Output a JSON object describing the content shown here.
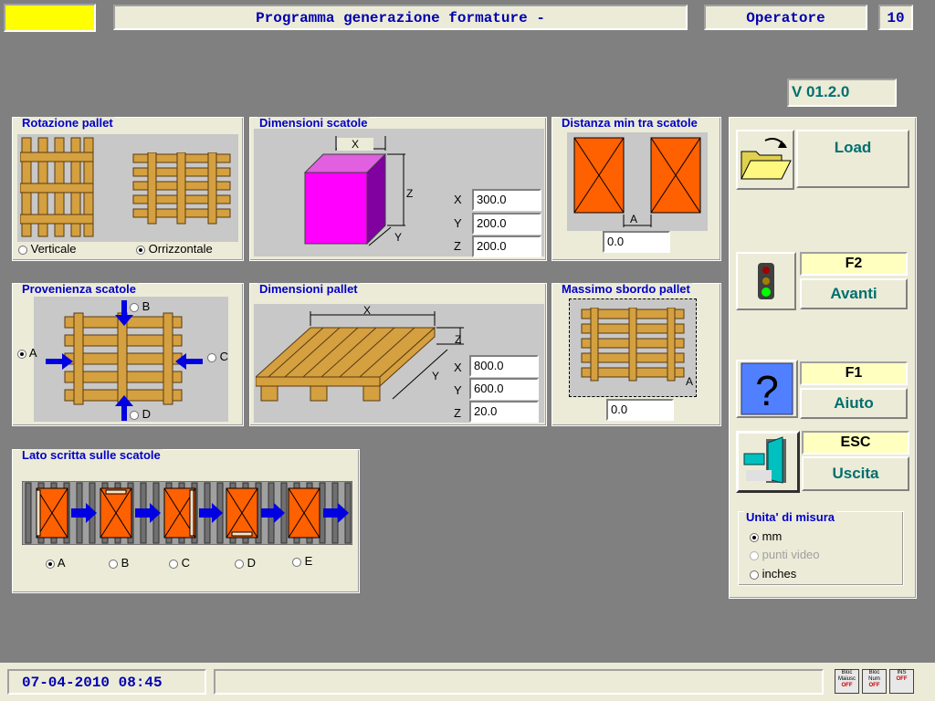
{
  "header": {
    "title": "Programma generazione formature -",
    "user": "Operatore",
    "level": "10",
    "indicator_color": "#ffff00"
  },
  "version": "V 01.2.0",
  "rotazione": {
    "title": "Rotazione pallet",
    "options": [
      "Verticale",
      "Orrizzontale"
    ],
    "selected": "Orrizzontale"
  },
  "dim_scatole": {
    "title": "Dimensioni scatole",
    "axis_x": "X",
    "axis_y": "Y",
    "axis_z": "Z",
    "x": "300.0",
    "y": "200.0",
    "z": "200.0"
  },
  "distanza": {
    "title": "Distanza min tra scatole",
    "axis": "A",
    "value": "0.0"
  },
  "provenienza": {
    "title": "Provenienza scatole",
    "options": [
      "A",
      "B",
      "C",
      "D"
    ],
    "selected": "A"
  },
  "dim_pallet": {
    "title": "Dimensioni pallet",
    "axis_x": "X",
    "axis_y": "Y",
    "axis_z": "Z",
    "x": "800.0",
    "y": "600.0",
    "z": "20.0"
  },
  "sbordo": {
    "title": "Massimo sbordo pallet",
    "axis": "A",
    "value": "0.0"
  },
  "lato_scritta": {
    "title": "Lato scritta sulle scatole",
    "options": [
      "A",
      "B",
      "C",
      "D",
      "E"
    ],
    "selected": "A"
  },
  "side_panel": {
    "load_label": "Load",
    "avanti_key": "F2",
    "avanti_label": "Avanti",
    "aiuto_key": "F1",
    "aiuto_label": "Aiuto",
    "uscita_key": "ESC",
    "uscita_label": "Uscita",
    "units_title": "Unita' di misura",
    "units": [
      "mm",
      "punti video",
      "inches"
    ],
    "units_selected": "mm"
  },
  "footer": {
    "datetime": "07-04-2010 08:45",
    "status_text": "",
    "indicators": [
      {
        "line1": "Bloc",
        "line2": "Maiusc",
        "state": "OFF"
      },
      {
        "line1": "Bloc",
        "line2": "Num",
        "state": "OFF"
      },
      {
        "line1": "INS",
        "line2": "",
        "state": "OFF"
      }
    ]
  }
}
